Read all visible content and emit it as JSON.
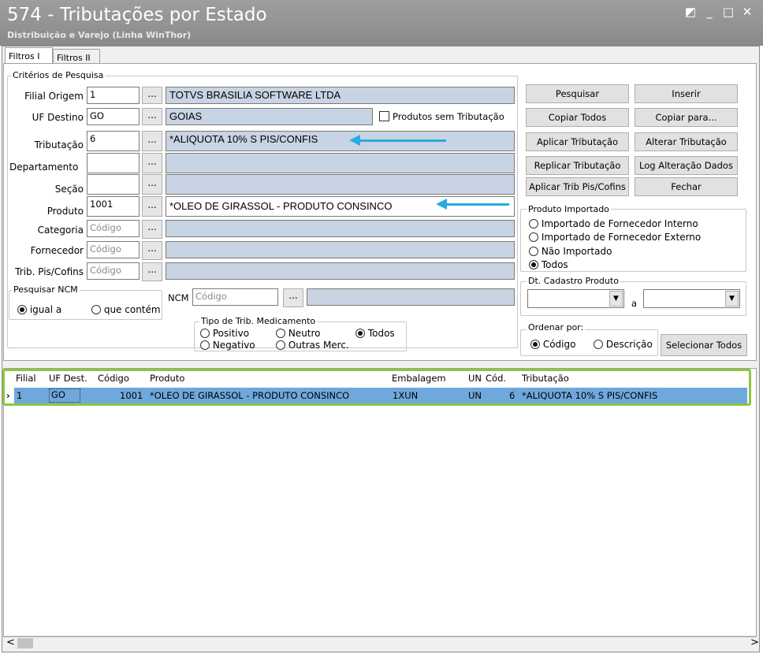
{
  "window": {
    "title": "574 - Tributações por Estado",
    "subtitle": "Distribuição e Varejo (Linha WinThor)",
    "controls": [
      "◩",
      "_",
      "□",
      "✕"
    ]
  },
  "tabs": [
    "Filtros I",
    "Filtros II"
  ],
  "criteria": {
    "group_label": "Critérios de Pesquisa",
    "filial_label": "Filial Origem",
    "filial_value": "1",
    "filial_desc": "TOTVS BRASILIA SOFTWARE LTDA",
    "uf_label": "UF Destino",
    "uf_value": "GO",
    "uf_desc": "GOIAS",
    "sem_trib_label": "Produtos sem Tributação",
    "trib_label": "Tributação",
    "trib_value": "6",
    "trib_desc": "*ALIQUOTA 10% S PIS/CONFIS",
    "depto_label": "Departamento",
    "secao_label": "Seção",
    "produto_label": "Produto",
    "produto_value": "1001",
    "produto_desc": "*OLEO DE GIRASSOL - PRODUTO CONSINCO",
    "categoria_label": "Categoria",
    "categoria_ph": "Código",
    "fornecedor_label": "Fornecedor",
    "fornecedor_ph": "Código",
    "pis_label": "Trib. Pis/Cofins",
    "pis_ph": "Código",
    "dots": "...",
    "ncm_group": "Pesquisar NCM",
    "ncm_igual": "igual a",
    "ncm_contem": "que contém",
    "ncm_label": "NCM",
    "ncm_ph": "Código",
    "med_group": "Tipo de Trib. Medicamento",
    "med_positivo": "Positivo",
    "med_neutro": "Neutro",
    "med_todos": "Todos",
    "med_negativo": "Negativo",
    "med_outras": "Outras Merc."
  },
  "buttons": {
    "pesquisar": "Pesquisar",
    "inserir": "Inserir",
    "copiar_todos": "Copiar Todos",
    "copiar_para": "Copiar para...",
    "aplicar_trib": "Aplicar Tributação",
    "alterar_trib": "Alterar Tributação",
    "replicar_trib": "Replicar Tributação",
    "log_alteracao": "Log Alteração Dados",
    "aplicar_pis": "Aplicar Trib Pis/Cofins",
    "fechar": "Fechar",
    "selecionar_todos": "Selecionar Todos"
  },
  "importado": {
    "group": "Produto Importado",
    "interno": "Importado de Fornecedor Interno",
    "externo": "Importado de Fornecedor Externo",
    "nao": "Não Importado",
    "todos": "Todos"
  },
  "cadastro": {
    "group": "Dt. Cadastro Produto",
    "a_label": "a"
  },
  "ordenar": {
    "group": "Ordenar por:",
    "codigo": "Código",
    "descricao": "Descrição"
  },
  "grid": {
    "columns": [
      "Filial",
      "UF Dest.",
      "Código",
      "Produto",
      "Embalagem",
      "UN",
      "Cód.",
      "Tributação"
    ],
    "rows": [
      {
        "filial": "1",
        "uf": "GO",
        "codigo": "1001",
        "produto": "*OLEO DE GIRASSOL - PRODUTO CONSINCO",
        "embalagem": "1XUN",
        "un": "UN",
        "cod": "6",
        "tributacao": "*ALIQUOTA 10% S PIS/CONFIS"
      }
    ],
    "scroll_left": "<",
    "scroll_right": ">"
  },
  "colors": {
    "accent_arrow": "#29abe2",
    "highlight_border": "#8dc63f",
    "row_selected": "#6fa8dc"
  }
}
